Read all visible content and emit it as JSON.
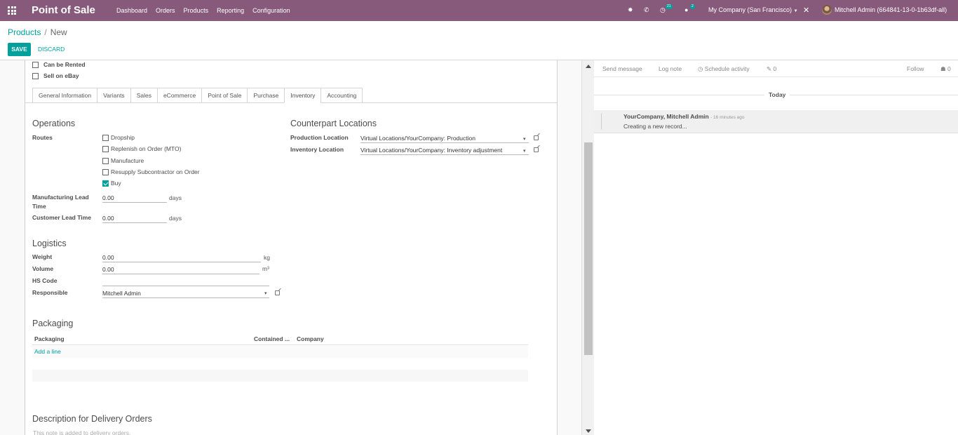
{
  "navbar": {
    "app_title": "Point of Sale",
    "menu": [
      "Dashboard",
      "Orders",
      "Products",
      "Reporting",
      "Configuration"
    ],
    "activity_badge": "21",
    "messages_badge": "2",
    "company": "My Company (San Francisco)",
    "user": "Mitchell Admin (664841-13-0-1b63df-all)"
  },
  "breadcrumb": {
    "parent": "Products",
    "separator": "/",
    "current": "New"
  },
  "buttons": {
    "save": "SAVE",
    "discard": "DISCARD"
  },
  "checkboxes_top": [
    {
      "label": "Can be Rented",
      "checked": false
    },
    {
      "label": "Sell on eBay",
      "checked": false
    }
  ],
  "tabs": [
    "General Information",
    "Variants",
    "Sales",
    "eCommerce",
    "Point of Sale",
    "Purchase",
    "Inventory",
    "Accounting"
  ],
  "active_tab": "Inventory",
  "operations": {
    "title": "Operations",
    "routes_label": "Routes",
    "routes": [
      {
        "label": "Dropship",
        "checked": false
      },
      {
        "label": "Replenish on Order (MTO)",
        "checked": false
      },
      {
        "label": "Manufacture",
        "checked": false
      },
      {
        "label": "Resupply Subcontractor on Order",
        "checked": false
      },
      {
        "label": "Buy",
        "checked": true
      }
    ],
    "mfg_lead_label_1": "Manufacturing Lead",
    "mfg_lead_label_2": "Time",
    "mfg_lead_value": "0.00",
    "mfg_lead_unit": "days",
    "customer_lead_label": "Customer Lead Time",
    "customer_lead_value": "0.00",
    "customer_lead_unit": "days"
  },
  "counterpart": {
    "title": "Counterpart Locations",
    "production_label": "Production Location",
    "production_value": "Virtual Locations/YourCompany: Production",
    "inventory_label": "Inventory Location",
    "inventory_value": "Virtual Locations/YourCompany: Inventory adjustment"
  },
  "logistics": {
    "title": "Logistics",
    "weight_label": "Weight",
    "weight_value": "0.00",
    "weight_unit": "kg",
    "volume_label": "Volume",
    "volume_value": "0.00",
    "volume_unit": "m³",
    "hs_code_label": "HS Code",
    "hs_code_value": "",
    "responsible_label": "Responsible",
    "responsible_value": "Mitchell Admin"
  },
  "packaging": {
    "title": "Packaging",
    "columns": [
      "Packaging",
      "Contained ...",
      "Company"
    ],
    "add_line": "Add a line"
  },
  "description_delivery": {
    "title": "Description for Delivery Orders",
    "placeholder": "This note is added to delivery orders."
  },
  "chatter": {
    "send_message": "Send message",
    "log_note": "Log note",
    "schedule_activity": "Schedule activity",
    "attachments_count": "0",
    "follow": "Follow",
    "followers_count": "0",
    "date_separator": "Today",
    "message": {
      "author": "YourCompany, Mitchell Admin",
      "time": "- 16 minutes ago",
      "body": "Creating a new record..."
    }
  },
  "colors": {
    "navbar": "#875a7b",
    "accent": "#00a09d"
  }
}
